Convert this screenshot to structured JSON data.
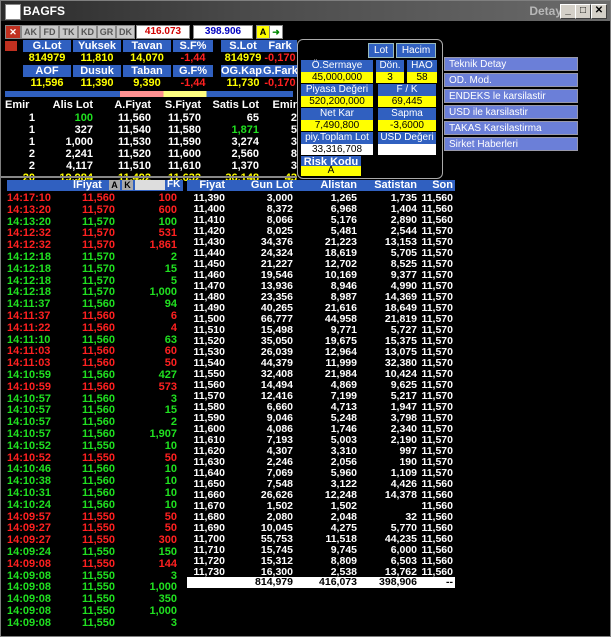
{
  "window": {
    "title": "BAGFS",
    "right_title": "Detay",
    "btn_min": "_",
    "btn_max": "□",
    "btn_close": "✕"
  },
  "toolbar": {
    "items": [
      "AK",
      "FD",
      "TK",
      "KD",
      "GR",
      "DK"
    ],
    "price1": "416.073",
    "price2": "398.906",
    "alert_label": "A"
  },
  "summary": {
    "headers1": [
      "G.Lot",
      "Yuksek",
      "Tavan",
      "S.F%",
      "S.Lot",
      "Fark"
    ],
    "values1": [
      "814979",
      "11,810",
      "14,070",
      "-1,44",
      "814979",
      "-0,170"
    ],
    "headers2": [
      "AOF",
      "Dusuk",
      "Taban",
      "G.F%",
      "OG.Kap.",
      "G.Fark"
    ],
    "values2": [
      "11,596",
      "11,390",
      "9,390",
      "-1,44",
      "11,730",
      "-0,170"
    ]
  },
  "depth": {
    "headers": [
      "Emir",
      "Alis Lot",
      "A.Fiyat",
      "S.Fiyat",
      "Satis Lot",
      "Emir"
    ],
    "rows": [
      [
        "1",
        "100",
        "11,560",
        "11,570",
        "65",
        "2"
      ],
      [
        "1",
        "327",
        "11,540",
        "11,580",
        "1,871",
        "5"
      ],
      [
        "1",
        "1,000",
        "11,530",
        "11,590",
        "3,274",
        "3"
      ],
      [
        "2",
        "2,241",
        "11,520",
        "11,600",
        "2,560",
        "8"
      ],
      [
        "2",
        "4,117",
        "11,510",
        "11,610",
        "1,370",
        "3"
      ]
    ],
    "totals": [
      "20",
      "19,984",
      "11,492",
      "11,632",
      "36,148",
      "43"
    ]
  },
  "panel": {
    "btn_lot": "Lot",
    "btn_hacim": "Hacim",
    "oserm_label": "Ö.Sermaye",
    "oserm_value": "45,000,000",
    "don_label": "Dön.",
    "don_value": "3",
    "hao_label": "HAO",
    "hao_value": "58",
    "piyasa_label": "Piyasa Değeri",
    "piyasa_value": "520,200,000",
    "fk_label": "F / K",
    "fk_value": "69,445",
    "netkar_label": "Net Kar",
    "netkar_value": "7,490,800",
    "sapma_label": "Sapma",
    "sapma_value": "-3,6000",
    "ptl_label": "piy.Toplam Lot",
    "ptl_value": "33,316,708",
    "usd_label": "USD Değeri",
    "risk_label": "Risk Kodu",
    "risk_value": "A"
  },
  "links": [
    "Teknik Detay",
    "OD. Mod.",
    "ENDEKS le karsilastir",
    "USD ile karsilastir",
    "TAKAS Karsilastirma",
    "Sirket Haberleri"
  ],
  "trades": {
    "header_label": "lFiyat",
    "a_label": "A",
    "k_label": "K",
    "fk_label": "FK",
    "rows": [
      [
        "14:17:10",
        "11,560",
        "100",
        "r"
      ],
      [
        "14:13:20",
        "11,570",
        "600",
        "r"
      ],
      [
        "14:13:20",
        "11,570",
        "100",
        "g"
      ],
      [
        "14:12:32",
        "11,570",
        "531",
        "r"
      ],
      [
        "14:12:32",
        "11,570",
        "1,861",
        "r"
      ],
      [
        "14:12:18",
        "11,570",
        "2",
        "g"
      ],
      [
        "14:12:18",
        "11,570",
        "15",
        "g"
      ],
      [
        "14:12:18",
        "11,570",
        "5",
        "g"
      ],
      [
        "14:12:18",
        "11,570",
        "1,000",
        "g"
      ],
      [
        "14:11:37",
        "11,560",
        "94",
        "g"
      ],
      [
        "14:11:37",
        "11,560",
        "6",
        "r"
      ],
      [
        "14:11:22",
        "11,560",
        "4",
        "r"
      ],
      [
        "14:11:10",
        "11,560",
        "63",
        "g"
      ],
      [
        "14:11:03",
        "11,560",
        "60",
        "r"
      ],
      [
        "14:11:03",
        "11,560",
        "50",
        "r"
      ],
      [
        "14:10:59",
        "11,560",
        "427",
        "g"
      ],
      [
        "14:10:59",
        "11,560",
        "573",
        "r"
      ],
      [
        "14:10:57",
        "11,560",
        "3",
        "g"
      ],
      [
        "14:10:57",
        "11,560",
        "15",
        "g"
      ],
      [
        "14:10:57",
        "11,560",
        "2",
        "g"
      ],
      [
        "14:10:57",
        "11,560",
        "1,907",
        "g"
      ],
      [
        "14:10:52",
        "11,550",
        "10",
        "g"
      ],
      [
        "14:10:52",
        "11,550",
        "50",
        "r"
      ],
      [
        "14:10:46",
        "11,560",
        "10",
        "g"
      ],
      [
        "14:10:38",
        "11,560",
        "10",
        "g"
      ],
      [
        "14:10:31",
        "11,560",
        "10",
        "g"
      ],
      [
        "14:10:24",
        "11,560",
        "10",
        "g"
      ],
      [
        "14:09:57",
        "11,550",
        "50",
        "r"
      ],
      [
        "14:09:27",
        "11,550",
        "50",
        "r"
      ],
      [
        "14:09:27",
        "11,550",
        "300",
        "r"
      ],
      [
        "14:09:24",
        "11,550",
        "150",
        "g"
      ],
      [
        "14:09:08",
        "11,550",
        "144",
        "r"
      ],
      [
        "14:09:08",
        "11,550",
        "3",
        "g"
      ],
      [
        "14:09:08",
        "11,550",
        "1,000",
        "g"
      ],
      [
        "14:09:08",
        "11,550",
        "350",
        "g"
      ],
      [
        "14:09:08",
        "11,550",
        "1,000",
        "g"
      ],
      [
        "14:09:08",
        "11,550",
        "3",
        "g"
      ]
    ]
  },
  "prices": {
    "headers": [
      "Fiyat",
      "Gun Lot",
      "Alistan",
      "Satistan",
      "Son"
    ],
    "rows": [
      [
        "11,390",
        "3,000",
        "1,265",
        "1,735",
        "11,560"
      ],
      [
        "11,400",
        "8,372",
        "6,968",
        "1,404",
        "11,560"
      ],
      [
        "11,410",
        "8,066",
        "5,176",
        "2,890",
        "11,560"
      ],
      [
        "11,420",
        "8,025",
        "5,481",
        "2,544",
        "11,570"
      ],
      [
        "11,430",
        "34,376",
        "21,223",
        "13,153",
        "11,570"
      ],
      [
        "11,440",
        "24,324",
        "18,619",
        "5,705",
        "11,570"
      ],
      [
        "11,450",
        "21,227",
        "12,702",
        "8,525",
        "11,570"
      ],
      [
        "11,460",
        "19,546",
        "10,169",
        "9,377",
        "11,570"
      ],
      [
        "11,470",
        "13,936",
        "8,946",
        "4,990",
        "11,570"
      ],
      [
        "11,480",
        "23,356",
        "8,987",
        "14,369",
        "11,570"
      ],
      [
        "11,490",
        "40,265",
        "21,616",
        "18,649",
        "11,570"
      ],
      [
        "11,500",
        "66,777",
        "44,958",
        "21,819",
        "11,570"
      ],
      [
        "11,510",
        "15,498",
        "9,771",
        "5,727",
        "11,570"
      ],
      [
        "11,520",
        "35,050",
        "19,675",
        "15,375",
        "11,570"
      ],
      [
        "11,530",
        "26,039",
        "12,964",
        "13,075",
        "11,570"
      ],
      [
        "11,540",
        "44,379",
        "11,999",
        "32,380",
        "11,570"
      ],
      [
        "11,550",
        "32,408",
        "21,984",
        "10,424",
        "11,570"
      ],
      [
        "11,560",
        "14,494",
        "4,869",
        "9,625",
        "11,570"
      ],
      [
        "11,570",
        "12,416",
        "7,199",
        "5,217",
        "11,570"
      ],
      [
        "11,580",
        "6,660",
        "4,713",
        "1,947",
        "11,570"
      ],
      [
        "11,590",
        "9,046",
        "5,248",
        "3,798",
        "11,570"
      ],
      [
        "11,600",
        "4,086",
        "1,746",
        "2,340",
        "11,570"
      ],
      [
        "11,610",
        "7,193",
        "5,003",
        "2,190",
        "11,570"
      ],
      [
        "11,620",
        "4,307",
        "3,310",
        "997",
        "11,570"
      ],
      [
        "11,630",
        "2,246",
        "2,056",
        "190",
        "11,570"
      ],
      [
        "11,640",
        "7,069",
        "5,960",
        "1,109",
        "11,570"
      ],
      [
        "11,650",
        "7,548",
        "3,122",
        "4,426",
        "11,560"
      ],
      [
        "11,660",
        "26,626",
        "12,248",
        "14,378",
        "11,560"
      ],
      [
        "11,670",
        "1,502",
        "1,502",
        "",
        "11,560"
      ],
      [
        "11,680",
        "2,080",
        "2,048",
        "32",
        "11,560"
      ],
      [
        "11,690",
        "10,045",
        "4,275",
        "5,770",
        "11,560"
      ],
      [
        "11,700",
        "55,753",
        "11,518",
        "44,235",
        "11,560"
      ],
      [
        "11,710",
        "15,745",
        "9,745",
        "6,000",
        "11,560"
      ],
      [
        "11,720",
        "15,312",
        "8,809",
        "6,503",
        "11,560"
      ],
      [
        "11,730",
        "16,300",
        "2,538",
        "13,762",
        "11,560"
      ]
    ],
    "totals": [
      "814,979",
      "416,073",
      "398,906",
      "--"
    ]
  }
}
